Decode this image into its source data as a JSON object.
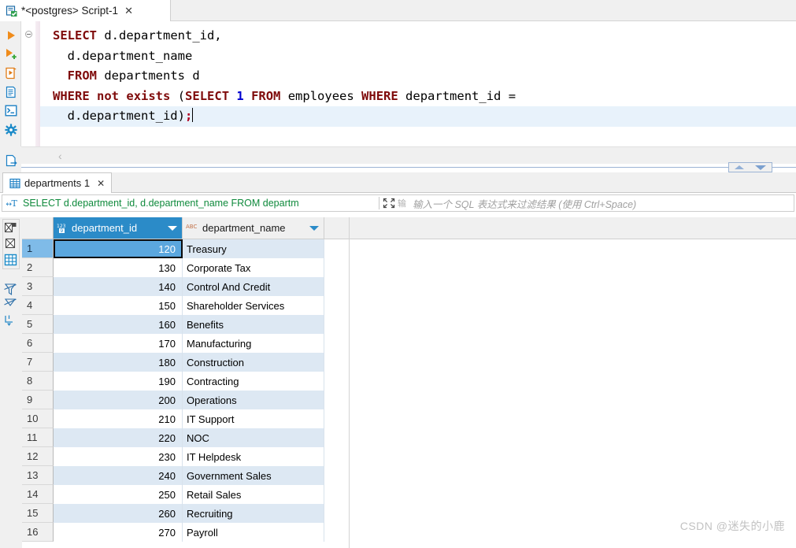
{
  "window": {
    "editor_tab": {
      "title": "*<postgres> Script-1",
      "close_label": "✕",
      "icon": "sql-script-icon"
    }
  },
  "editor_toolbar": {
    "buttons": [
      {
        "name": "execute-statement",
        "icon": "play-icon"
      },
      {
        "name": "execute-new-tab",
        "icon": "play-plus-icon"
      },
      {
        "name": "execute-script",
        "icon": "execute-script-icon"
      },
      {
        "name": "explain-execution-plan",
        "icon": "script-document-icon"
      },
      {
        "name": "execute-in-console",
        "icon": "console-icon"
      },
      {
        "name": "configure",
        "icon": "gear-icon"
      },
      {
        "name": "more-options",
        "icon": "dots-icon"
      },
      {
        "name": "export-data",
        "icon": "export-document-icon"
      }
    ],
    "warning_icon": "warning-triangle-icon"
  },
  "sql": {
    "lines": [
      [
        {
          "t": "SELECT",
          "c": "kw"
        },
        {
          "t": " d.department_id,",
          "c": "id"
        }
      ],
      [
        {
          "t": "  d.department_name",
          "c": "id"
        }
      ],
      [
        {
          "t": "  ",
          "c": "id"
        },
        {
          "t": "FROM",
          "c": "kw"
        },
        {
          "t": " departments d",
          "c": "id"
        }
      ],
      [
        {
          "t": "WHERE",
          "c": "kw"
        },
        {
          "t": " ",
          "c": "id"
        },
        {
          "t": "not",
          "c": "kw"
        },
        {
          "t": " ",
          "c": "id"
        },
        {
          "t": "exists",
          "c": "kw"
        },
        {
          "t": " (",
          "c": "id"
        },
        {
          "t": "SELECT",
          "c": "kw"
        },
        {
          "t": " ",
          "c": "id"
        },
        {
          "t": "1",
          "c": "num"
        },
        {
          "t": " ",
          "c": "id"
        },
        {
          "t": "FROM",
          "c": "kw"
        },
        {
          "t": " employees ",
          "c": "id"
        },
        {
          "t": "WHERE",
          "c": "kw"
        },
        {
          "t": " department_id =",
          "c": "id"
        }
      ],
      [
        {
          "t": "  d.department_id)",
          "c": "id"
        },
        {
          "t": ";",
          "c": "semi"
        }
      ]
    ],
    "current_line_index": 4
  },
  "divider": {
    "collapse_chevron": "‹",
    "sash_up_icon": "triangle-up-icon",
    "sash_down_icon": "triangle-down-icon"
  },
  "results": {
    "tab": {
      "label": "departments 1",
      "close_label": "✕",
      "icon": "result-grid-icon"
    },
    "filter_bar": {
      "icon": "filter-text-icon",
      "query": "SELECT d.department_id, d.department_name FROM departm",
      "expand_icon": "expand-arrows-icon",
      "keyboard_icon": "input-method-icon",
      "placeholder": "输入一个 SQL 表达式来过滤结果 (使用 Ctrl+Space)"
    },
    "side_toolbar": {
      "buttons": [
        {
          "name": "panel-toggle-record",
          "icon": "record-panel-icon"
        },
        {
          "name": "panel-toggle-value",
          "icon": "value-panel-icon"
        },
        {
          "name": "grid-view",
          "icon": "grid-icon"
        },
        {
          "name": "filter-settings",
          "icon": "filter-off-icon"
        },
        {
          "name": "sort-settings",
          "icon": "sort-off-icon"
        },
        {
          "name": "calc-settings",
          "icon": "calc-column-icon"
        }
      ]
    },
    "grid": {
      "columns": [
        {
          "name": "department_id",
          "type_icon": "numeric-type-icon",
          "selected": true
        },
        {
          "name": "department_name",
          "type_icon": "text-type-icon",
          "selected": false
        }
      ],
      "rows": [
        {
          "n": "1",
          "department_id": "120",
          "department_name": "Treasury"
        },
        {
          "n": "2",
          "department_id": "130",
          "department_name": "Corporate Tax"
        },
        {
          "n": "3",
          "department_id": "140",
          "department_name": "Control And Credit"
        },
        {
          "n": "4",
          "department_id": "150",
          "department_name": "Shareholder Services"
        },
        {
          "n": "5",
          "department_id": "160",
          "department_name": "Benefits"
        },
        {
          "n": "6",
          "department_id": "170",
          "department_name": "Manufacturing"
        },
        {
          "n": "7",
          "department_id": "180",
          "department_name": "Construction"
        },
        {
          "n": "8",
          "department_id": "190",
          "department_name": "Contracting"
        },
        {
          "n": "9",
          "department_id": "200",
          "department_name": "Operations"
        },
        {
          "n": "10",
          "department_id": "210",
          "department_name": "IT Support"
        },
        {
          "n": "11",
          "department_id": "220",
          "department_name": "NOC"
        },
        {
          "n": "12",
          "department_id": "230",
          "department_name": "IT Helpdesk"
        },
        {
          "n": "13",
          "department_id": "240",
          "department_name": "Government Sales"
        },
        {
          "n": "14",
          "department_id": "250",
          "department_name": "Retail Sales"
        },
        {
          "n": "15",
          "department_id": "260",
          "department_name": "Recruiting"
        },
        {
          "n": "16",
          "department_id": "270",
          "department_name": "Payroll"
        }
      ],
      "selected_row_index": 0,
      "selected_column_index": 0
    }
  },
  "watermark": {
    "text": "CSDN @迷失的小鹿"
  },
  "colors": {
    "accent_blue": "#2b8bc8",
    "selection_cell": "#5ba7de",
    "row_stripe": "#dde8f3",
    "keyword_red": "#7f0b0b",
    "query_green": "#0f8a3c",
    "warning_red": "#c0392b"
  }
}
